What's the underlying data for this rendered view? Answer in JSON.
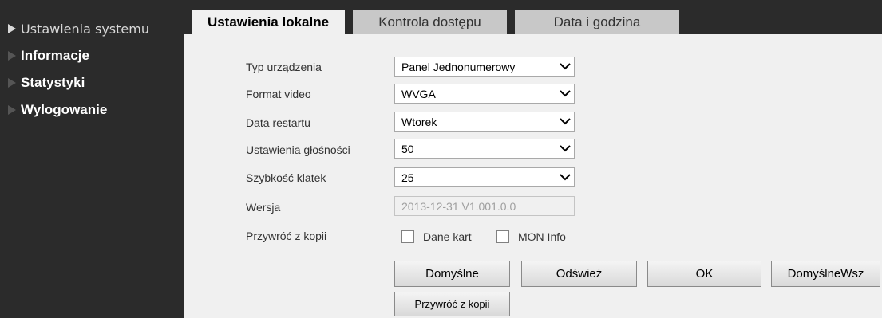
{
  "sidebar": {
    "items": [
      {
        "label": "Ustawienia systemu",
        "active": true
      },
      {
        "label": "Informacje",
        "active": false
      },
      {
        "label": "Statystyki",
        "active": false
      },
      {
        "label": "Wylogowanie",
        "active": false
      }
    ]
  },
  "tabs": [
    {
      "label": "Ustawienia lokalne",
      "active": true
    },
    {
      "label": "Kontrola dostępu",
      "active": false
    },
    {
      "label": "Data i godzina",
      "active": false
    }
  ],
  "form": {
    "device_type": {
      "label": "Typ urządzenia",
      "value": "Panel Jednonumerowy"
    },
    "video_format": {
      "label": "Format video",
      "value": "WVGA"
    },
    "restart_day": {
      "label": "Data restartu",
      "value": "Wtorek"
    },
    "volume": {
      "label": "Ustawienia głośności",
      "value": "50"
    },
    "frame_rate": {
      "label": "Szybkość klatek",
      "value": "25"
    },
    "version": {
      "label": "Wersja",
      "value": "2013-12-31 V1.001.0.0"
    },
    "restore": {
      "label": "Przywróć z kopii",
      "options": [
        {
          "label": "Dane kart",
          "checked": false
        },
        {
          "label": "MON Info",
          "checked": false
        }
      ]
    }
  },
  "buttons": {
    "defaults": "Domyślne",
    "refresh": "Odśwież",
    "ok": "OK",
    "defaults_all": "DomyślneWsz",
    "restore_backup": "Przywróć z kopii"
  },
  "colors": {
    "sidebar_bg": "#2b2b2b",
    "content_bg": "#f0f0f0",
    "inactive_tab": "#c8c8c8",
    "arrow_active": "#d8d8d8",
    "arrow_inactive": "#555555"
  },
  "icons": {
    "sidebar_arrow": "triangle-right-icon",
    "select_chevron": "chevron-down-icon"
  }
}
